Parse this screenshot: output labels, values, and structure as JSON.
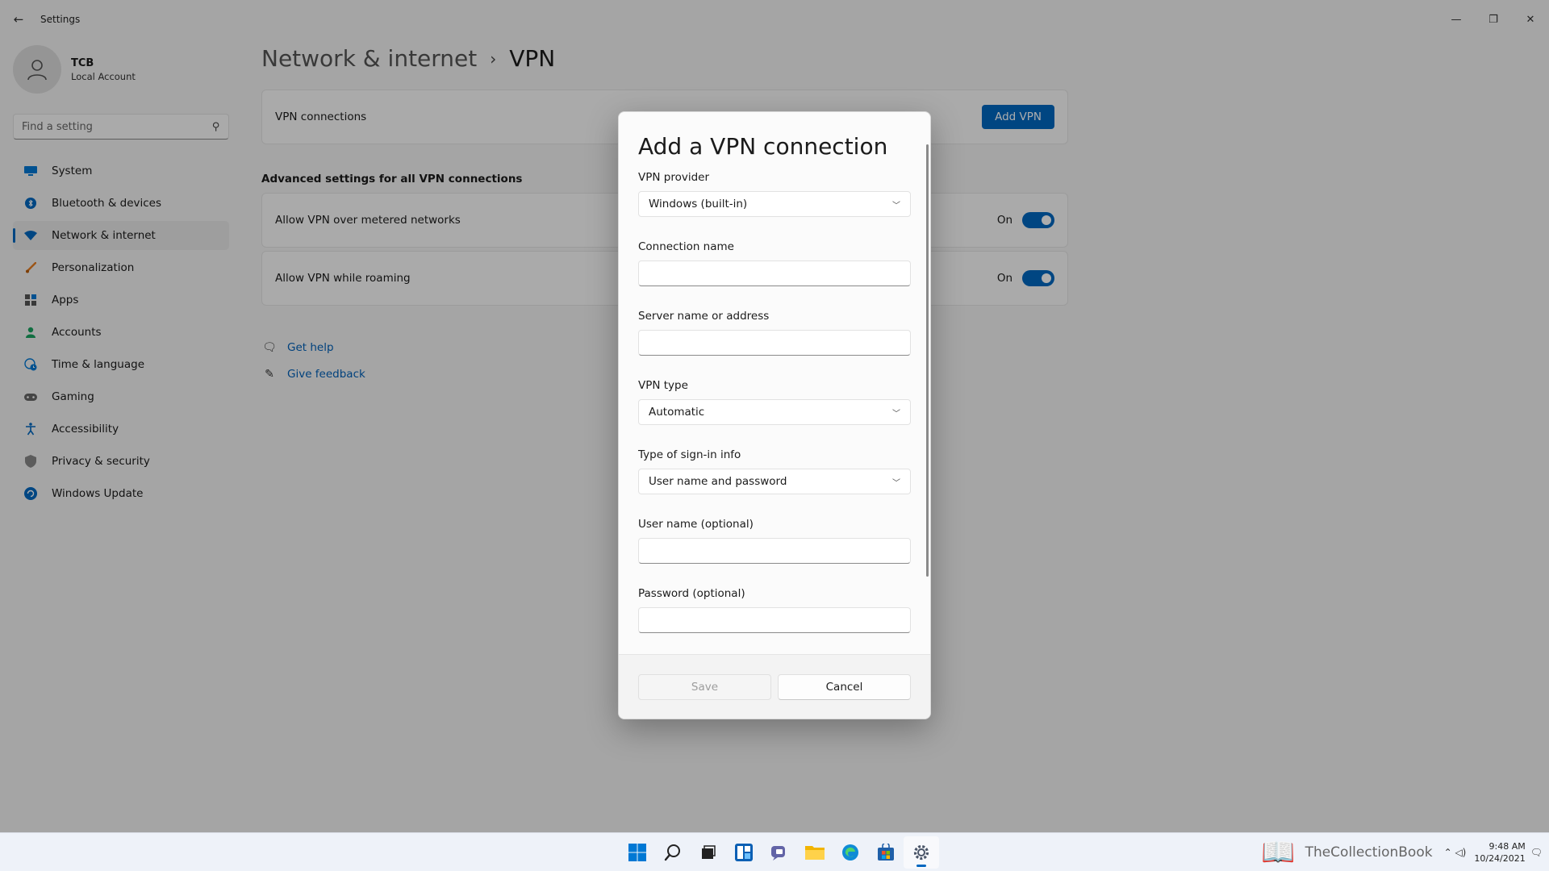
{
  "window": {
    "app_title": "Settings",
    "back_glyph": "←",
    "minimize_glyph": "—",
    "maximize_glyph": "❐",
    "close_glyph": "✕"
  },
  "profile": {
    "name": "TCB",
    "account_type": "Local Account"
  },
  "search": {
    "placeholder": "Find a setting",
    "icon": "search-icon"
  },
  "nav": {
    "items": [
      {
        "label": "System",
        "icon": "system-icon",
        "color": "#0078d4"
      },
      {
        "label": "Bluetooth & devices",
        "icon": "bluetooth-icon",
        "color": "#0067c0"
      },
      {
        "label": "Network & internet",
        "icon": "wifi-icon",
        "color": "#0067c0",
        "active": true
      },
      {
        "label": "Personalization",
        "icon": "brush-icon",
        "color": "#e67e22"
      },
      {
        "label": "Apps",
        "icon": "apps-icon",
        "color": "#555555"
      },
      {
        "label": "Accounts",
        "icon": "accounts-icon",
        "color": "#1aa260"
      },
      {
        "label": "Time & language",
        "icon": "globe-clock-icon",
        "color": "#0078d4"
      },
      {
        "label": "Gaming",
        "icon": "gamepad-icon",
        "color": "#666666"
      },
      {
        "label": "Accessibility",
        "icon": "accessibility-icon",
        "color": "#0067c0"
      },
      {
        "label": "Privacy & security",
        "icon": "shield-icon",
        "color": "#777777"
      },
      {
        "label": "Windows Update",
        "icon": "update-icon",
        "color": "#0067c0"
      }
    ]
  },
  "breadcrumb": {
    "parent": "Network & internet",
    "separator": "›",
    "current": "VPN"
  },
  "vpn_connections": {
    "label": "VPN connections",
    "add_button": "Add VPN"
  },
  "advanced": {
    "title": "Advanced settings for all VPN connections",
    "metered": {
      "label": "Allow VPN over metered networks",
      "state": "On"
    },
    "roaming": {
      "label": "Allow VPN while roaming",
      "state": "On"
    }
  },
  "help": {
    "get_help": "Get help",
    "give_feedback": "Give feedback"
  },
  "dialog": {
    "title": "Add a VPN connection",
    "vpn_provider": {
      "label": "VPN provider",
      "value": "Windows (built-in)"
    },
    "connection_name": {
      "label": "Connection name",
      "value": ""
    },
    "server": {
      "label": "Server name or address",
      "value": ""
    },
    "vpn_type": {
      "label": "VPN type",
      "value": "Automatic"
    },
    "signin_type": {
      "label": "Type of sign-in info",
      "value": "User name and password"
    },
    "username": {
      "label": "User name (optional)",
      "value": ""
    },
    "password": {
      "label": "Password (optional)",
      "value": ""
    },
    "save_label": "Save",
    "cancel_label": "Cancel"
  },
  "taskbar": {
    "watermark": "TheCollectionBook",
    "time": "9:48 AM",
    "date": "10/24/2021",
    "tray_glyphs": "⌃ ◁)"
  },
  "colors": {
    "accent": "#0067c0"
  }
}
